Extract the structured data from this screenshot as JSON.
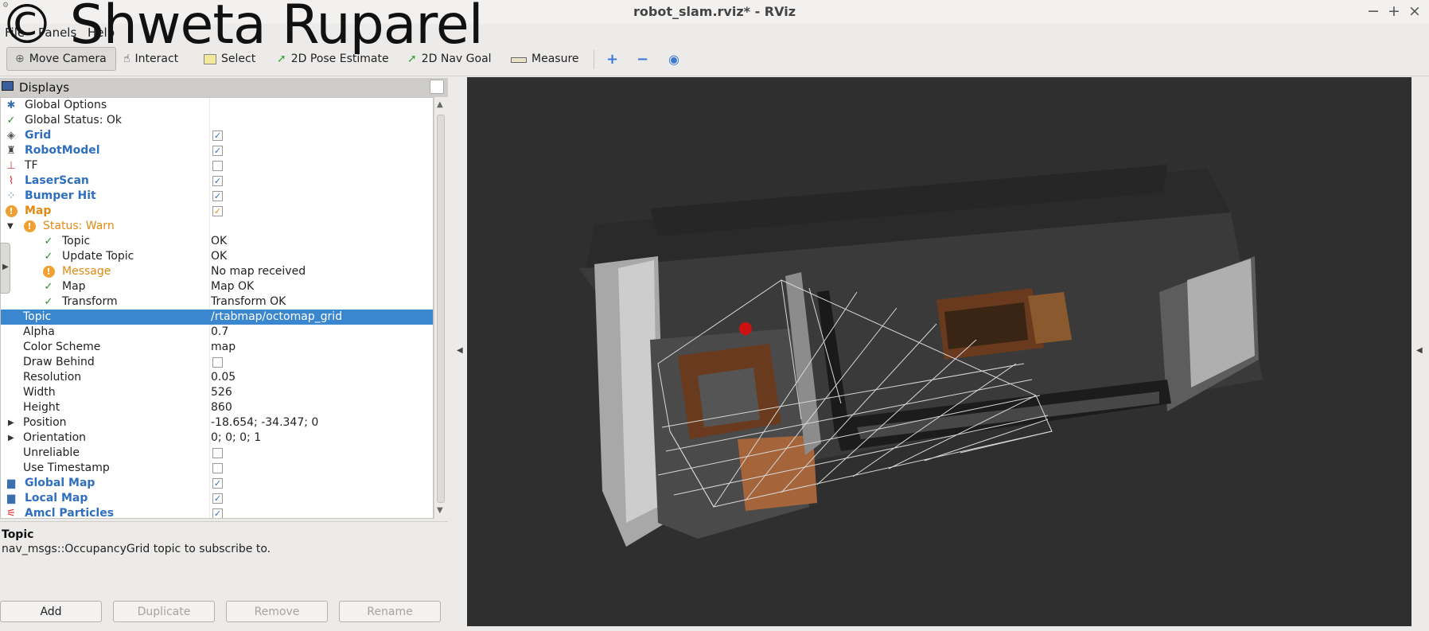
{
  "window": {
    "title": "robot_slam.rviz* - RViz",
    "controls": [
      "−",
      "+",
      "×"
    ],
    "watermark": "© Shweta Ruparel"
  },
  "menu": [
    "File",
    "Panels",
    "Help"
  ],
  "toolbar": {
    "tools": [
      {
        "label": "Move Camera",
        "icon": "move-camera-icon",
        "active": true
      },
      {
        "label": "Interact",
        "icon": "hand-icon"
      },
      {
        "label": "Select",
        "icon": "select-box-icon"
      },
      {
        "label": "2D Pose Estimate",
        "icon": "green-arrow-icon"
      },
      {
        "label": "2D Nav Goal",
        "icon": "green-arrow-icon"
      },
      {
        "label": "Measure",
        "icon": "ruler-icon"
      }
    ],
    "view_tools": [
      "plus-icon",
      "minus-icon",
      "eye-icon"
    ]
  },
  "displays_panel": {
    "title": "Displays",
    "rows": [
      {
        "name": "Global Options",
        "value": ""
      },
      {
        "name": "Global Status: Ok",
        "value": ""
      },
      {
        "name": "Grid",
        "value": "",
        "checked": true
      },
      {
        "name": "RobotModel",
        "value": "",
        "checked": true
      },
      {
        "name": "TF",
        "value": "",
        "checked": false
      },
      {
        "name": "LaserScan",
        "value": "",
        "checked": true
      },
      {
        "name": "Bumper Hit",
        "value": "",
        "checked": true
      },
      {
        "name": "Map",
        "value": "",
        "checked": true
      },
      {
        "name": "Status: Warn",
        "value": ""
      },
      {
        "name": "Topic",
        "value": "OK"
      },
      {
        "name": "Update Topic",
        "value": "OK"
      },
      {
        "name": "Message",
        "value": "No map received"
      },
      {
        "name": "Map",
        "value": "Map OK"
      },
      {
        "name": "Transform",
        "value": "Transform OK"
      },
      {
        "name": "Topic",
        "value": "/rtabmap/octomap_grid",
        "selected": true
      },
      {
        "name": "Alpha",
        "value": "0.7"
      },
      {
        "name": "Color Scheme",
        "value": "map"
      },
      {
        "name": "Draw Behind",
        "value": "",
        "checked": false
      },
      {
        "name": "Resolution",
        "value": "0.05"
      },
      {
        "name": "Width",
        "value": "526"
      },
      {
        "name": "Height",
        "value": "860"
      },
      {
        "name": "Position",
        "value": "-18.654; -34.347; 0"
      },
      {
        "name": "Orientation",
        "value": "0; 0; 0; 1"
      },
      {
        "name": "Unreliable",
        "value": "",
        "checked": false
      },
      {
        "name": "Use Timestamp",
        "value": "",
        "checked": false
      },
      {
        "name": "Global Map",
        "value": "",
        "checked": true
      },
      {
        "name": "Local Map",
        "value": "",
        "checked": true
      },
      {
        "name": "Amcl Particles",
        "value": "",
        "checked": true
      }
    ]
  },
  "description": {
    "title": "Topic",
    "text": "nav_msgs::OccupancyGrid topic to subscribe to."
  },
  "buttons": [
    {
      "label": "Add",
      "enabled": true
    },
    {
      "label": "Duplicate",
      "enabled": false
    },
    {
      "label": "Remove",
      "enabled": false
    },
    {
      "label": "Rename",
      "enabled": false
    }
  ],
  "viewport": {
    "background": "#2f2f2f",
    "grid_color": "#d8d8d8"
  }
}
